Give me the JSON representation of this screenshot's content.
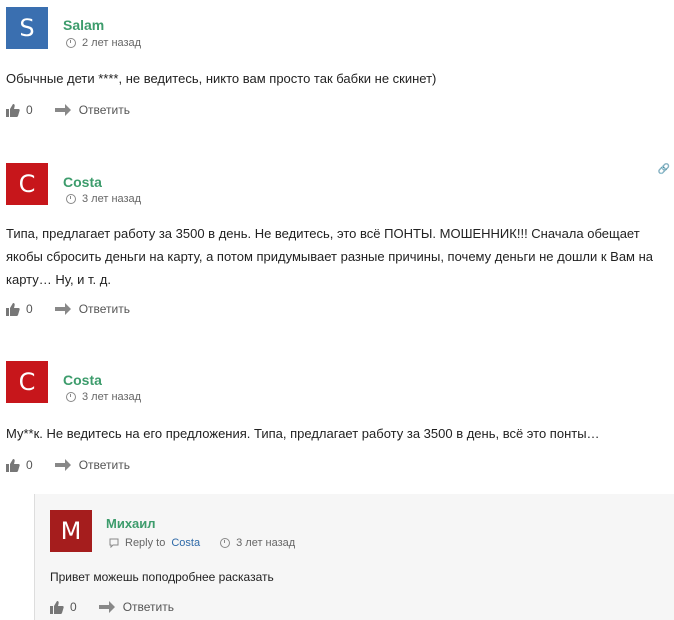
{
  "comments": [
    {
      "initial": "S",
      "avatar_color": "#3a6fb0",
      "author": "Salam",
      "time": "2 лет назад",
      "text": "Обычные дети ****, не ведитесь, никто вам просто так бабки не скинет)",
      "votes": "0",
      "reply_label": "Ответить"
    },
    {
      "initial": "C",
      "avatar_color": "#c7161b",
      "author": "Costa",
      "time": "3 лет назад",
      "text": "Типа, предлагает работу за 3500 в день. Не ведитесь, это всё ПОНТЫ. МОШЕННИК!!! Сначала обещает якобы сбросить деньги на карту, а потом придумывает разные причины, почему деньги не дошли к Вам на карту… Ну, и т. д.",
      "votes": "0",
      "reply_label": "Ответить"
    },
    {
      "initial": "C",
      "avatar_color": "#c7161b",
      "author": "Costa",
      "time": "3 лет назад",
      "text": "Му**к. Не ведитесь на его предложения. Типа, предлагает работу за 3500 в день, всё это понты…",
      "votes": "0",
      "reply_label": "Ответить"
    }
  ],
  "reply": {
    "initial": "M",
    "avatar_color": "#a51d1d",
    "author": "Михаил",
    "reply_to_label": "Reply to",
    "reply_to_name": "Costa",
    "time": "3 лет назад",
    "text": "Привет можешь поподробнее расказать",
    "votes": "0",
    "reply_label": "Ответить"
  },
  "icons": {
    "thumb": "thumbs-up-icon",
    "reply": "reply-arrow-icon",
    "clock": "clock-icon",
    "link": "link-icon"
  },
  "colors": {
    "author": "#3d9c6c",
    "link": "#2f6aa8"
  }
}
